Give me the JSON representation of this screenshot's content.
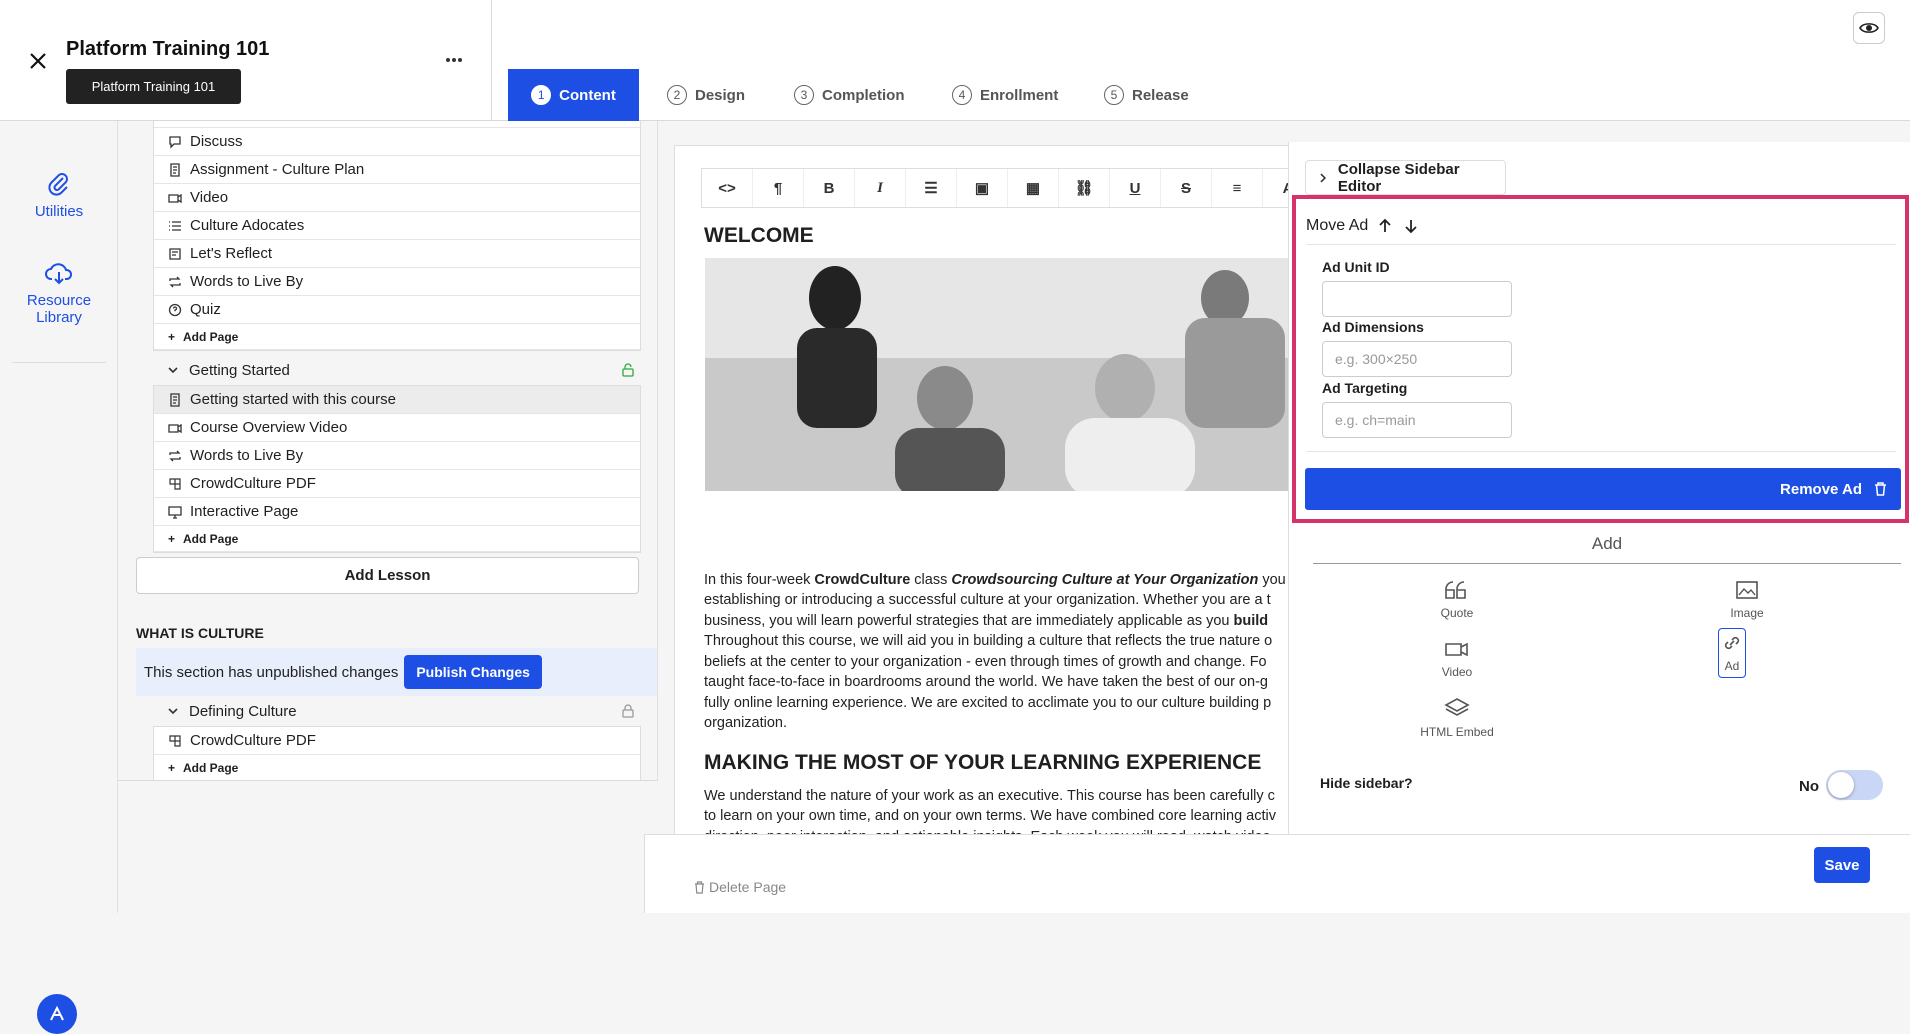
{
  "header": {
    "course_title": "Platform Training 101",
    "tooltip": "Platform Training 101",
    "tabs": [
      {
        "num": "1",
        "label": "Content"
      },
      {
        "num": "2",
        "label": "Design"
      },
      {
        "num": "3",
        "label": "Completion"
      },
      {
        "num": "4",
        "label": "Enrollment"
      },
      {
        "num": "5",
        "label": "Release"
      }
    ]
  },
  "rail": {
    "utilities": "Utilities",
    "resource_line1": "Resource",
    "resource_line2": "Library"
  },
  "outline": {
    "lesson1_pages": [
      "Discuss",
      "Assignment - Culture Plan",
      "Video",
      "Culture Adocates",
      "Let's Reflect",
      "Words to Live By",
      "Quiz"
    ],
    "add_page": "Add Page",
    "lesson2_title": "Getting Started",
    "lesson2_pages": [
      "Getting started with this course",
      "Course Overview Video",
      "Words to Live By",
      "CrowdCulture PDF",
      "Interactive Page"
    ],
    "add_lesson": "Add Lesson",
    "section_title": "WHAT IS CULTURE",
    "unpublished_text": "This section has unpublished changes",
    "publish_button": "Publish Changes",
    "lesson3_title": "Defining Culture",
    "lesson3_pages": [
      "CrowdCulture PDF"
    ]
  },
  "editor": {
    "welcome": "WELCOME",
    "p1_line1_a": "In this four-week ",
    "p1_line1_b": "CrowdCulture",
    "p1_line1_c": " class ",
    "p1_line1_d": "Crowdsourcing Culture at Your Organization",
    "p1_line1_e": " you",
    "p1_line2": "establishing or introducing a successful culture at your organization. Whether you are a t",
    "p1_line3_a": "business, you will learn powerful strategies that are immediately applicable as you ",
    "p1_line3_b": "build",
    "p1_line4": "Throughout this course, we will aid you in building a culture that reflects the true nature o",
    "p1_line5": "beliefs at the center to your organization - even through times of growth and change. Fo",
    "p1_line6": "taught face-to-face in boardrooms around the world. We have taken the best of our on-g",
    "p1_line7": "fully online learning experience. We are excited to acclimate you to our culture building p",
    "p1_line8": "organization.",
    "making": "MAKING THE MOST OF YOUR LEARNING EXPERIENCE",
    "p2_line1": "We understand the nature of your work as an executive. This course has been carefully c",
    "p2_line2": "to learn on your own time, and on your own terms. We have combined core learning activ",
    "p2_line3": "direction, peer interaction, and actionable insights. Each week you will read, watch video"
  },
  "sidebar": {
    "collapse": "Collapse Sidebar Editor",
    "move_ad": "Move Ad",
    "ad_unit_label": "Ad Unit ID",
    "ad_unit_value": "",
    "ad_dim_label": "Ad Dimensions",
    "ad_dim_placeholder": "e.g. 300×250",
    "ad_target_label": "Ad Targeting",
    "ad_target_placeholder": "e.g. ch=main",
    "remove_ad": "Remove Ad",
    "add_title": "Add",
    "blocks": {
      "quote": "Quote",
      "image": "Image",
      "video": "Video",
      "ad": "Ad",
      "html": "HTML Embed"
    },
    "hide_sidebar": "Hide sidebar?",
    "hide_value": "No"
  },
  "footer": {
    "delete_page": "Delete Page",
    "save": "Save"
  },
  "colors": {
    "accent": "#1d4fe5",
    "highlight": "#d6336c"
  }
}
